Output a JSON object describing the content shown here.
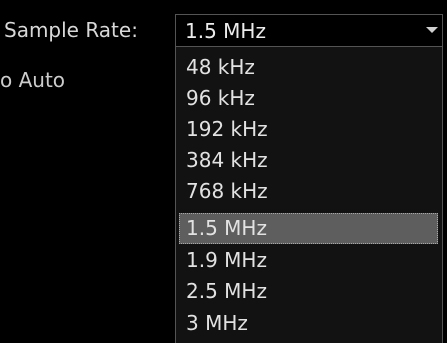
{
  "settings": {
    "sample_rate_label": "Sample Rate:",
    "auto_label": "o Auto"
  },
  "sample_rate_combo": {
    "selected_value": "1.5 MHz",
    "arrow_icon": "chevron-down-icon",
    "options": [
      {
        "label": "48 kHz",
        "selected": false
      },
      {
        "label": "96 kHz",
        "selected": false
      },
      {
        "label": "192 kHz",
        "selected": false
      },
      {
        "label": "384 kHz",
        "selected": false
      },
      {
        "label": "768 kHz",
        "selected": false
      },
      {
        "label": "1.5 MHz",
        "selected": true
      },
      {
        "label": "1.9 MHz",
        "selected": false
      },
      {
        "label": "2.5 MHz",
        "selected": false
      },
      {
        "label": "3 MHz",
        "selected": false
      }
    ]
  },
  "colors": {
    "background": "#000000",
    "dropdown_background": "#121212",
    "highlight": "#5e5e5e",
    "border": "#545454",
    "text": "#e2e2e2"
  }
}
